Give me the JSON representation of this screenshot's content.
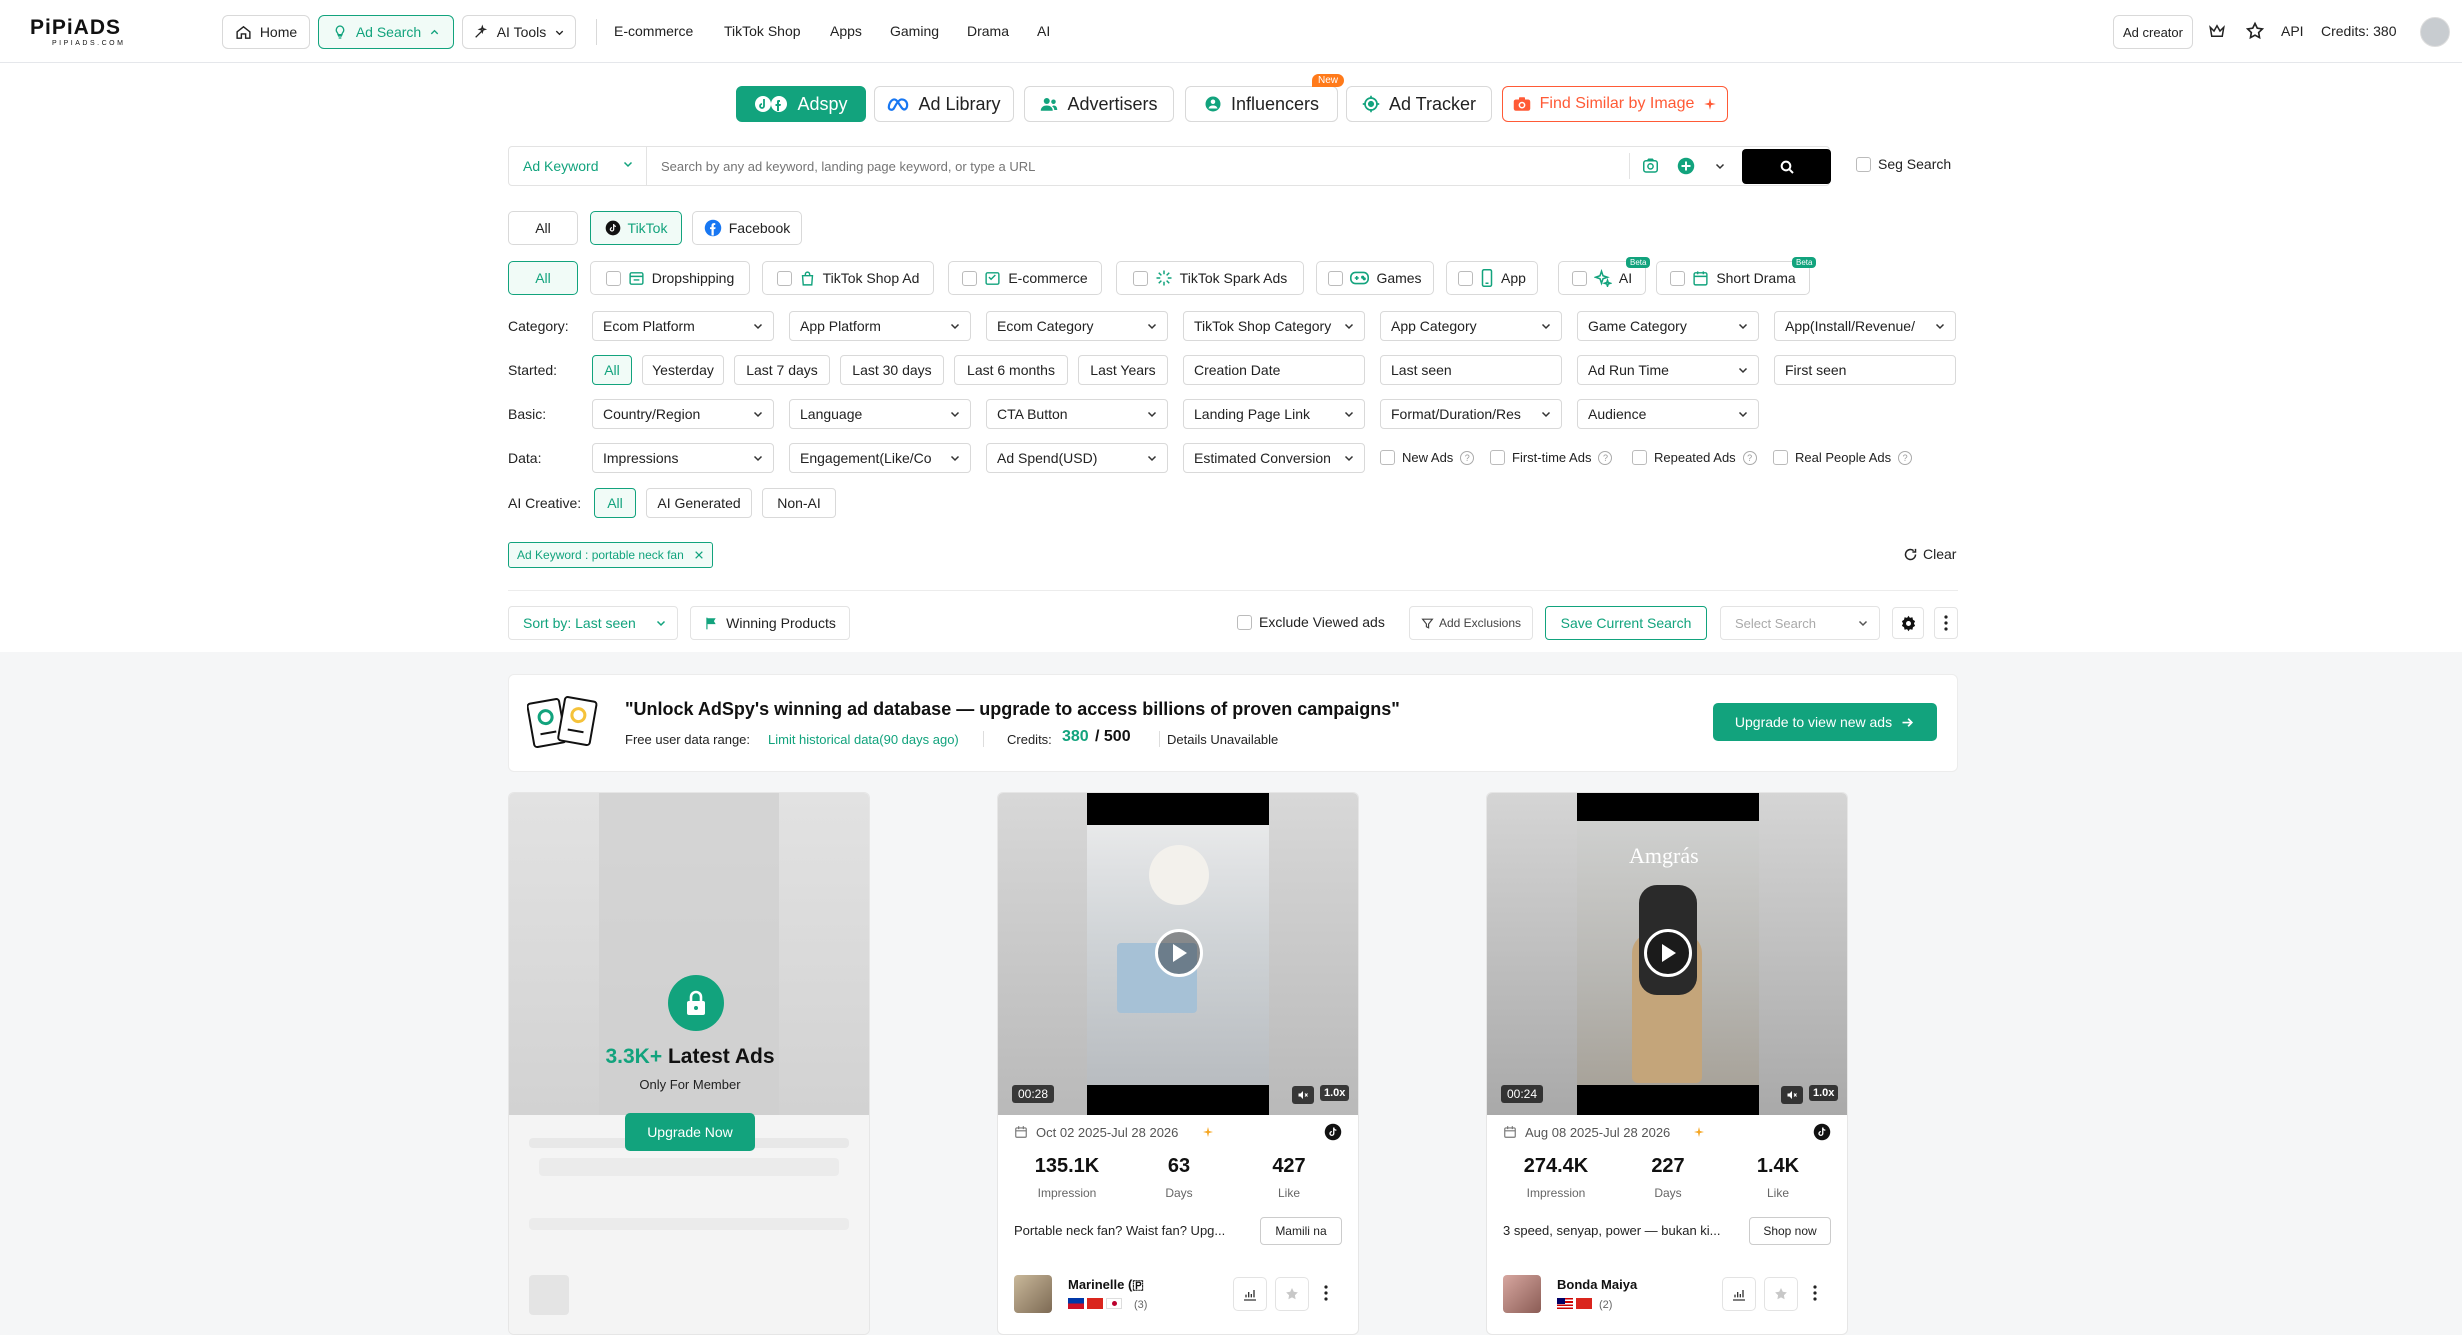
{
  "topnav": {
    "logo_main": "PiPiADS",
    "logo_sub": "PIPIADS.COM",
    "home": "Home",
    "ad_search": "Ad Search",
    "ai_tools": "AI Tools",
    "links": [
      "E-commerce",
      "TikTok Shop",
      "Apps",
      "Gaming",
      "Drama",
      "AI"
    ],
    "ad_creator": "Ad creator",
    "api": "API",
    "credits": "Credits: 380"
  },
  "product_tabs": {
    "adspy": "Adspy",
    "ad_library": "Ad Library",
    "advertisers": "Advertisers",
    "influencers": "Influencers",
    "influencers_badge": "New",
    "ad_tracker": "Ad Tracker",
    "find_similar": "Find Similar by Image"
  },
  "search": {
    "type": "Ad Keyword",
    "placeholder": "Search by any ad keyword, landing page keyword, or type a URL",
    "seg_search": "Seg Search"
  },
  "platforms": [
    "All",
    "TikTok",
    "Facebook"
  ],
  "ad_types": {
    "all": "All",
    "items": [
      "Dropshipping",
      "TikTok Shop Ad",
      "E-commerce",
      "TikTok Spark Ads",
      "Games",
      "App",
      "AI",
      "Short Drama"
    ],
    "beta": "Beta"
  },
  "filters": {
    "category_label": "Category:",
    "category": [
      "Ecom Platform",
      "App Platform",
      "Ecom Category",
      "TikTok Shop Category",
      "App Category",
      "Game Category",
      "App(Install/Revenue/"
    ],
    "started_label": "Started:",
    "started_chips": [
      "All",
      "Yesterday",
      "Last 7 days",
      "Last 30 days",
      "Last 6 months",
      "Last Years"
    ],
    "creation_date": "Creation Date",
    "last_seen": "Last seen",
    "ad_run_time": "Ad Run Time",
    "first_seen": "First seen",
    "basic_label": "Basic:",
    "basic": [
      "Country/Region",
      "Language",
      "CTA Button",
      "Landing Page Link",
      "Format/Duration/Res",
      "Audience"
    ],
    "data_label": "Data:",
    "data": [
      "Impressions",
      "Engagement(Like/Co",
      "Ad Spend(USD)",
      "Estimated Conversion"
    ],
    "data_checks": [
      "New Ads",
      "First-time Ads",
      "Repeated Ads",
      "Real People Ads"
    ],
    "ai_creative_label": "AI Creative:",
    "ai_creative": [
      "All",
      "AI Generated",
      "Non-AI"
    ],
    "active_tag": "Ad Keyword : portable neck fan",
    "clear": "Clear"
  },
  "toolbar": {
    "sort": "Sort by: Last seen",
    "winning_products": "Winning Products",
    "exclude_viewed": "Exclude Viewed ads",
    "add_exclusions": "Add Exclusions",
    "save_search": "Save Current Search",
    "select_search": "Select Search"
  },
  "promo": {
    "headline": "\"Unlock AdSpy's winning ad database — upgrade to access billions of proven campaigns\"",
    "range_label": "Free user data range:",
    "range_value": "Limit historical data(90 days ago)",
    "credits_label": "Credits:",
    "credits_used": "380",
    "credits_total": "/ 500",
    "details": "Details Unavailable",
    "upgrade_button": "Upgrade to view new ads"
  },
  "locked_card": {
    "count": "3.3K+",
    "count_label": "Latest Ads",
    "sub": "Only For Member",
    "button": "Upgrade Now"
  },
  "ads": [
    {
      "duration": "00:28",
      "speed": "1.0x",
      "dates": "Oct 02 2025-Jul 28 2026",
      "impression": "135.1K",
      "days": "63",
      "like": "427",
      "impression_label": "Impression",
      "days_label": "Days",
      "like_label": "Like",
      "text": "Portable neck fan? Waist fan? Upg...",
      "cta": "Mamili na",
      "advertiser": "Marinelle (🇵",
      "count": "(3)"
    },
    {
      "duration": "00:24",
      "speed": "1.0x",
      "dates": "Aug 08 2025-Jul 28 2026",
      "impression": "274.4K",
      "days": "227",
      "like": "1.4K",
      "impression_label": "Impression",
      "days_label": "Days",
      "like_label": "Like",
      "text": "3 speed, senyap, power — bukan ki...",
      "cta": "Shop now",
      "advertiser": "Bonda Maiya",
      "count": "(2)",
      "overlay_text": "Amgrás"
    }
  ],
  "colors": {
    "accent": "#12a37d",
    "orange": "#ff5a36"
  }
}
